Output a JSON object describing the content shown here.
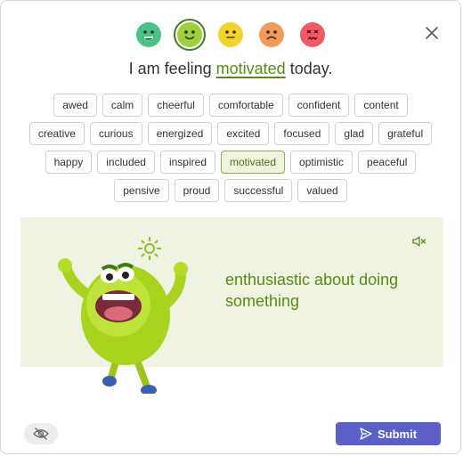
{
  "moods": [
    {
      "icon": "grinning-face-icon",
      "color": "#49c387"
    },
    {
      "icon": "smiling-face-icon",
      "color": "#9fd03b",
      "selected": true
    },
    {
      "icon": "neutral-face-icon",
      "color": "#f3d22b"
    },
    {
      "icon": "sad-face-icon",
      "color": "#f29a5c"
    },
    {
      "icon": "upset-face-icon",
      "color": "#ee5b65"
    }
  ],
  "feeling": {
    "prefix": "I am feeling",
    "word": "motivated",
    "suffix": "today."
  },
  "emotions": [
    "awed",
    "calm",
    "cheerful",
    "comfortable",
    "confident",
    "content",
    "creative",
    "curious",
    "energized",
    "excited",
    "focused",
    "glad",
    "grateful",
    "happy",
    "included",
    "inspired",
    "motivated",
    "optimistic",
    "peaceful",
    "pensive",
    "proud",
    "successful",
    "valued"
  ],
  "selected_emotion": "motivated",
  "definition": "enthusiastic about doing something",
  "colors": {
    "accent_green": "#5a8a16",
    "panel_bg": "#eef3e2",
    "submit_bg": "#5b5fc7"
  },
  "submit_label": "Submit"
}
